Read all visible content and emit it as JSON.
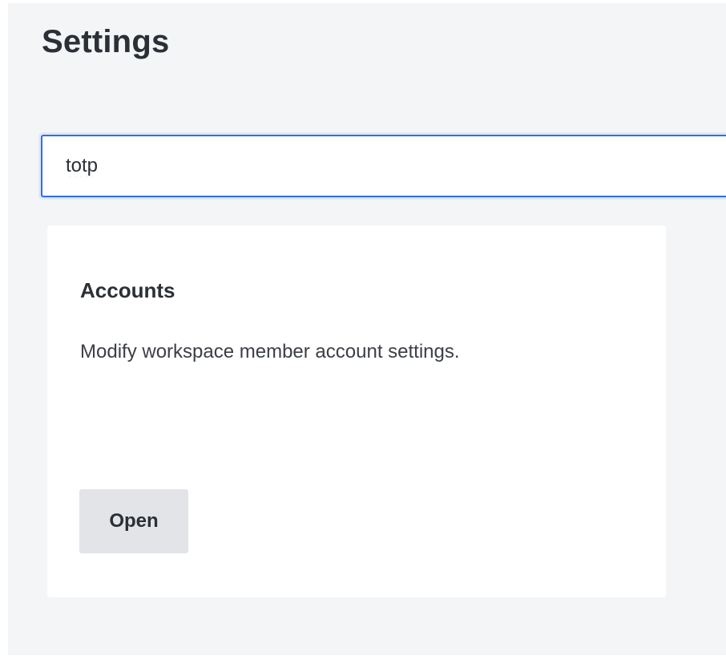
{
  "header": {
    "title": "Settings"
  },
  "search": {
    "value": "totp",
    "accent_color": "#2f6df2"
  },
  "result_card": {
    "title": "Accounts",
    "description": "Modify workspace member account settings.",
    "open_label": "Open"
  }
}
